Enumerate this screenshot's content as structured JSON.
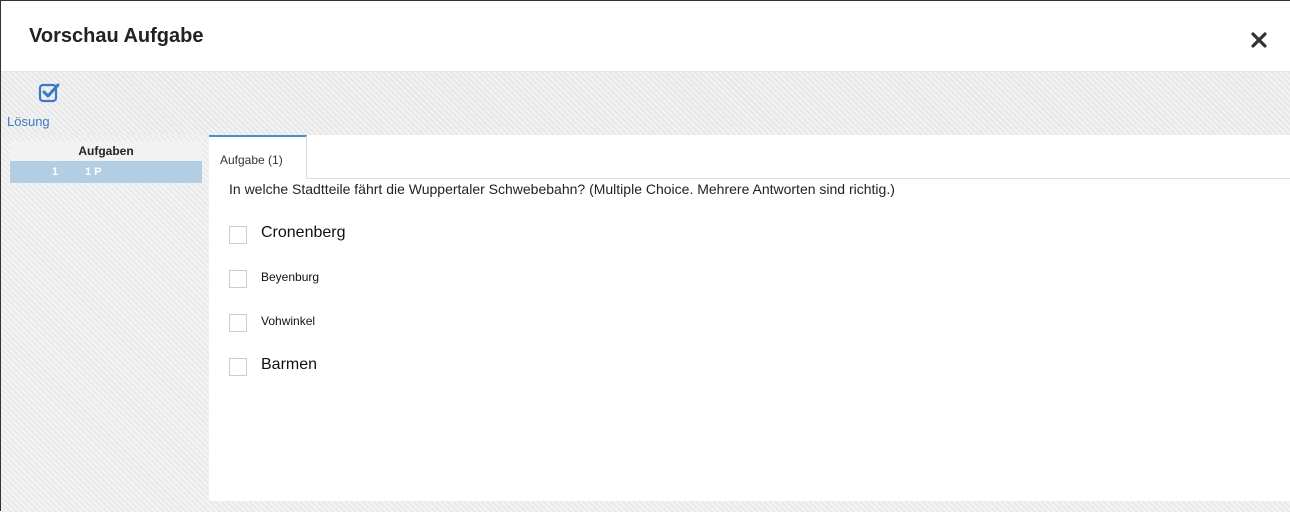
{
  "dialog": {
    "title": "Vorschau Aufgabe",
    "close_icon": "close-icon"
  },
  "toolbar": {
    "solution_label": "Lösung",
    "solution_icon": "checkbox-checked-icon",
    "accent_color": "#3a7cc4"
  },
  "tasks_panel": {
    "header": "Aufgaben",
    "items": [
      {
        "number": "1",
        "points": "1 P",
        "selected": true
      }
    ]
  },
  "main": {
    "tab_label": "Aufgabe (1)",
    "question": "In welche Stadtteile fährt die Wuppertaler Schwebebahn? (Multiple Choice. Mehrere Antworten sind richtig.)",
    "answers": [
      {
        "label": "Cronenberg",
        "checked": false
      },
      {
        "label": "Beyenburg",
        "checked": false
      },
      {
        "label": "Vohwinkel",
        "checked": false
      },
      {
        "label": "Barmen",
        "checked": false
      }
    ]
  }
}
